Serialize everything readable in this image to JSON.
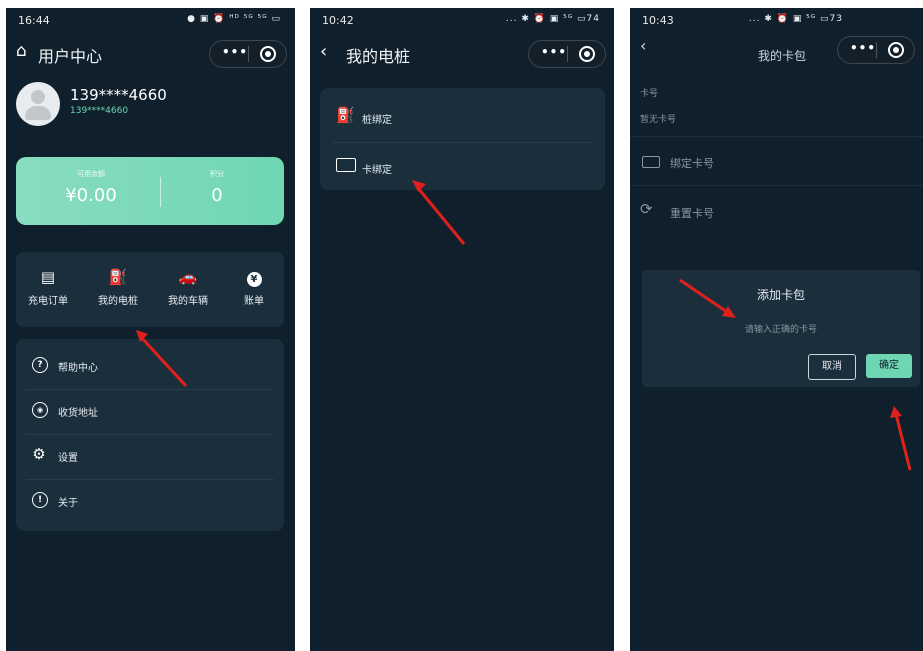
{
  "screen1": {
    "status": {
      "time": "16:44",
      "icons": "● ▣  ⏰ ᴴᴰ ⁵ᴳ ⁵ᴳ ▭"
    },
    "title": "用户中心",
    "user": {
      "name": "139****4660",
      "sub": "139****4660"
    },
    "balance": {
      "label": "可用余额",
      "value": "¥0.00"
    },
    "points": {
      "label": "积分",
      "value": "0"
    },
    "quick": [
      {
        "icon": "▤",
        "label": "充电订单"
      },
      {
        "icon": "⛽",
        "label": "我的电桩"
      },
      {
        "icon": "🚗",
        "label": "我的车辆"
      },
      {
        "icon": "¥",
        "label": "账单"
      }
    ],
    "menu": [
      {
        "icon": "?",
        "label": "帮助中心"
      },
      {
        "icon": "◉",
        "label": "收货地址"
      },
      {
        "icon": "⚙",
        "label": "设置"
      },
      {
        "icon": "!",
        "label": "关于"
      }
    ]
  },
  "screen2": {
    "status": {
      "time": "10:42",
      "icons": "... ✱ ⏰ ▣ ⁵ᴳ ▭74"
    },
    "title": "我的电桩",
    "items": [
      {
        "label": "桩绑定"
      },
      {
        "label": "卡绑定"
      }
    ]
  },
  "screen3": {
    "status": {
      "time": "10:43",
      "icons": "... ✱ ⏰ ▣ ⁵ᴳ ▭73"
    },
    "title": "我的卡包",
    "card_label": "卡号",
    "no_card": "暂无卡号",
    "items": [
      {
        "label": "绑定卡号"
      },
      {
        "label": "重置卡号"
      }
    ],
    "dialog": {
      "title": "添加卡包",
      "placeholder": "请输入正确的卡号",
      "cancel": "取消",
      "confirm": "确定"
    }
  },
  "colors": {
    "background": "#0f1f2b",
    "card": "#1b2e3c",
    "accent": "#6fd6b3",
    "arrow": "#e0201c"
  }
}
